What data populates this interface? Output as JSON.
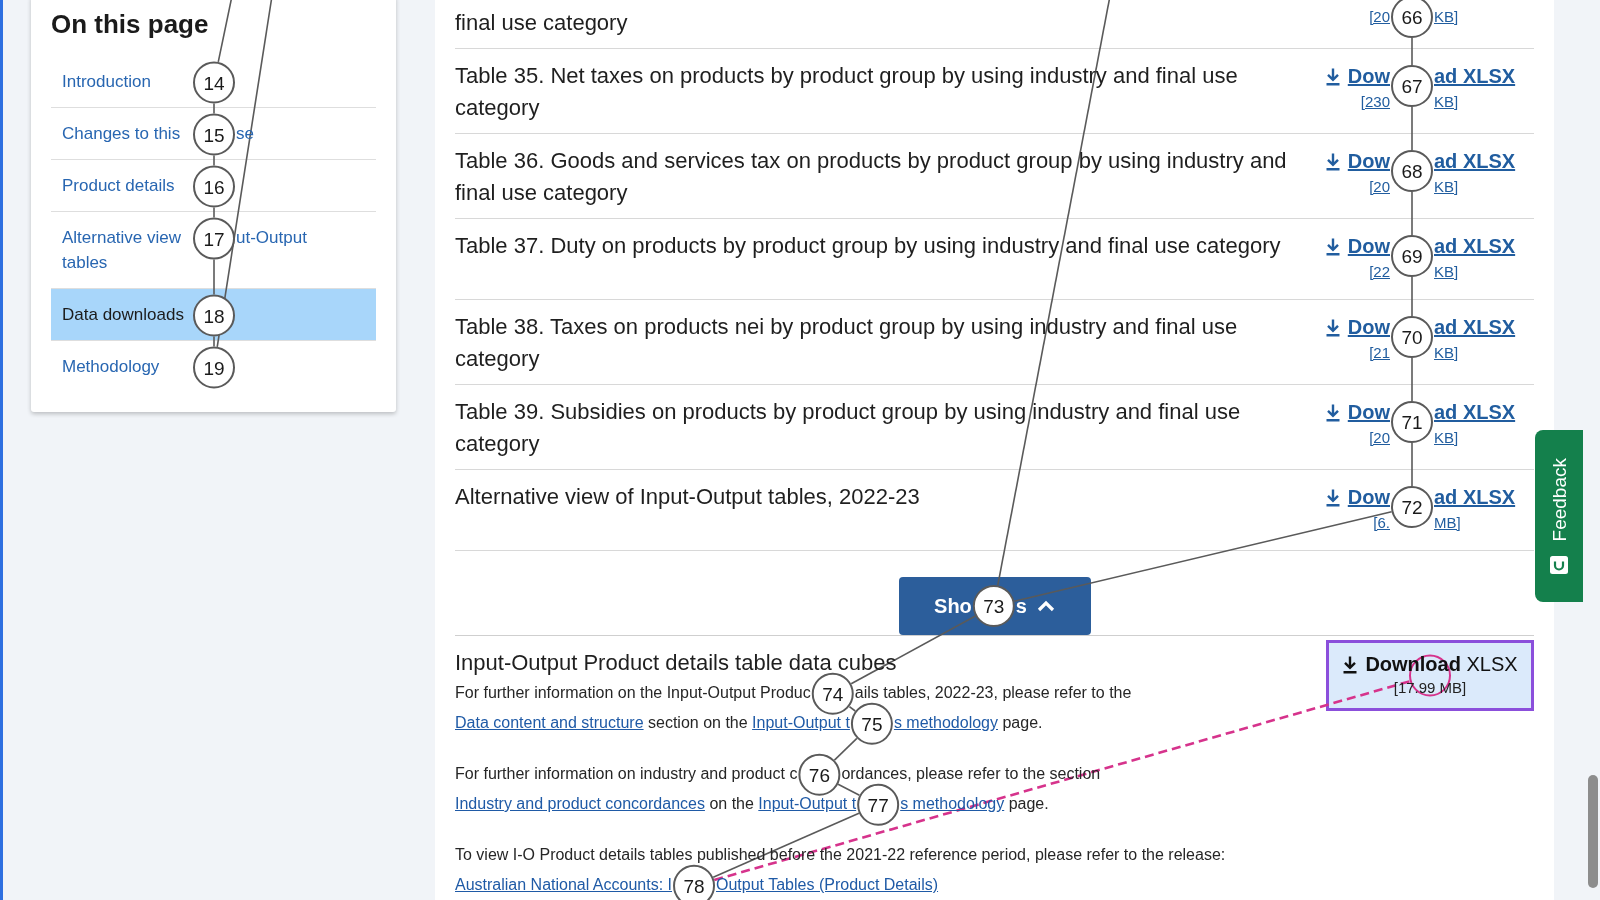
{
  "sidebar": {
    "title": "On this page",
    "items": [
      {
        "label": "Introduction",
        "selected": false,
        "marker": "14"
      },
      {
        "label": [
          "Changes to this",
          "se"
        ],
        "selected": false,
        "marker": "15"
      },
      {
        "label": "Product details",
        "selected": false,
        "marker": "16"
      },
      {
        "label": [
          "Alternative view",
          "ut-Output",
          "tables"
        ],
        "selected": false,
        "marker": "17"
      },
      {
        "label": "Data downloads",
        "selected": true,
        "marker": "18"
      },
      {
        "label": "Methodology",
        "selected": false,
        "marker": "19"
      }
    ]
  },
  "download_rows": [
    {
      "title": "final use category",
      "size": [
        "[20",
        "KB]"
      ],
      "marker": "66"
    },
    {
      "title": "Table 35. Net taxes on products by product group by using industry and final use category",
      "download": [
        "Dow",
        "ad XLSX"
      ],
      "size": [
        "[230",
        "KB]"
      ],
      "marker": "67"
    },
    {
      "title": "Table 36. Goods and services tax on products by product group by using industry and final use category",
      "download": [
        "Dow",
        "ad XLSX"
      ],
      "size": [
        "[20",
        "KB]"
      ],
      "marker": "68"
    },
    {
      "title": "Table 37. Duty on products by product group by using industry and final use category",
      "download": [
        "Dow",
        "ad XLSX"
      ],
      "size": [
        "[22",
        "KB]"
      ],
      "marker": "69"
    },
    {
      "title": "Table 38. Taxes on products nei by product group by using industry and final use category",
      "download": [
        "Dow",
        "ad XLSX"
      ],
      "size": [
        "[21",
        "KB]"
      ],
      "marker": "70"
    },
    {
      "title": "Table 39. Subsidies on products by product group by using industry and final use category",
      "download": [
        "Dow",
        "ad XLSX"
      ],
      "size": [
        "[20",
        "KB]"
      ],
      "marker": "71"
    },
    {
      "title": "Alternative view of Input-Output tables, 2022-23",
      "download": [
        "Dow",
        "ad XLSX"
      ],
      "size": [
        "[6.",
        "MB]"
      ],
      "marker": "72"
    }
  ],
  "toggle_button": {
    "label": [
      "Sho",
      "s"
    ],
    "marker": "73"
  },
  "data_cube": {
    "title": "Input-Output Product details table data cubes",
    "download": {
      "label": "**Download** XLSX",
      "size": "[17.99 MB]",
      "highlighted": true
    },
    "paragraphs": [
      {
        "parts": [
          {
            "kind": "text",
            "text": "For further information on the Input-Output Produc"
          },
          {
            "kind": "marker",
            "text": "74",
            "pointer": false
          },
          {
            "kind": "text",
            "text": "ails tables, 2022-23, please refer to the "
          },
          {
            "kind": "link",
            "text": "Data content and structure"
          },
          {
            "kind": "text",
            "text": " section on the "
          },
          {
            "kind": "link",
            "text": "Input-Output t"
          },
          {
            "kind": "marker",
            "text": "75",
            "pointer": false
          },
          {
            "kind": "link",
            "text": "s methodology"
          },
          {
            "kind": "text",
            "text": " page."
          }
        ]
      },
      {
        "parts": [
          {
            "kind": "text",
            "text": "For further information on industry and product c"
          },
          {
            "kind": "marker",
            "text": "76",
            "pointer": false
          },
          {
            "kind": "text",
            "text": "ordances, please refer to the section "
          },
          {
            "kind": "link",
            "text": "Industry and product concordances"
          },
          {
            "kind": "text",
            "text": " on the "
          },
          {
            "kind": "link",
            "text": "Input-Output t"
          },
          {
            "kind": "marker",
            "text": "77",
            "pointer": false
          },
          {
            "kind": "link",
            "text": "s methodology"
          },
          {
            "kind": "text",
            "text": " page."
          }
        ]
      },
      {
        "parts": [
          {
            "kind": "text",
            "text": "To view I-O Product details tables published before the 2021-22 reference period, please refer to the release: "
          },
          {
            "kind": "link",
            "text": "Australian National Accounts: I"
          },
          {
            "kind": "marker",
            "text": "78",
            "pointer": true
          },
          {
            "kind": "link",
            "text": "Output Tables (Product Details)"
          }
        ]
      }
    ]
  },
  "feedback_tab": {
    "label": "Feedback"
  }
}
